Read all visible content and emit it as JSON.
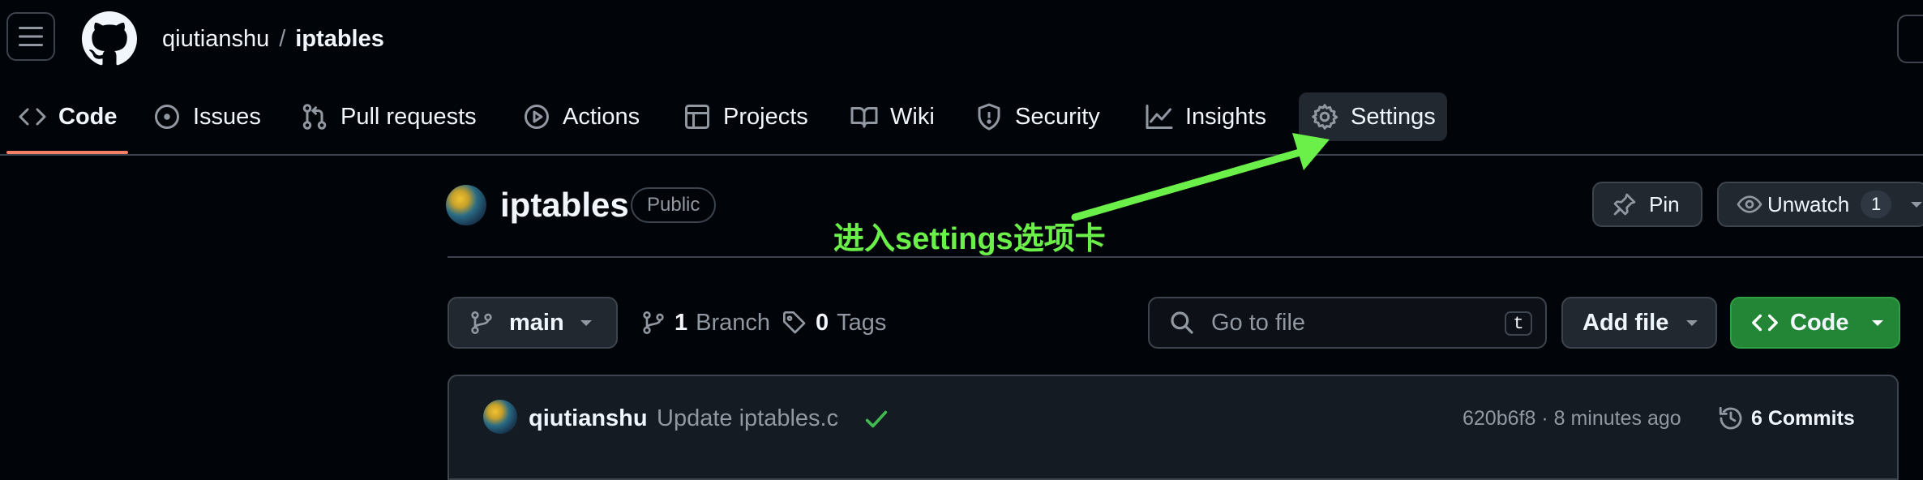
{
  "header": {
    "owner": "qiutianshu",
    "separator": "/",
    "repo": "iptables"
  },
  "tabs": [
    {
      "label": "Code",
      "icon": "code-icon",
      "active": true
    },
    {
      "label": "Issues",
      "icon": "issue-icon"
    },
    {
      "label": "Pull requests",
      "icon": "pull-request-icon"
    },
    {
      "label": "Actions",
      "icon": "play-icon"
    },
    {
      "label": "Projects",
      "icon": "table-icon"
    },
    {
      "label": "Wiki",
      "icon": "book-icon"
    },
    {
      "label": "Security",
      "icon": "shield-icon"
    },
    {
      "label": "Insights",
      "icon": "graph-icon"
    },
    {
      "label": "Settings",
      "icon": "gear-icon"
    }
  ],
  "repo_header": {
    "name": "iptables",
    "visibility": "Public",
    "pin_label": "Pin",
    "unwatch_label": "Unwatch",
    "watch_count": "1"
  },
  "annotation": {
    "text": "进入settings选项卡",
    "color": "#6bf04a"
  },
  "toolbar": {
    "branch": "main",
    "branch_count": "1",
    "branch_label": "Branch",
    "tag_count": "0",
    "tag_label": "Tags",
    "search_placeholder": "Go to file",
    "search_shortcut": "t",
    "add_file_label": "Add file",
    "code_label": "Code"
  },
  "commit": {
    "author": "qiutianshu",
    "message": "Update iptables.c",
    "hash": "620b6f8",
    "time": "8 minutes ago",
    "meta_separator": "·",
    "commit_count": "6",
    "commits_label": "Commits"
  },
  "colors": {
    "background": "#010409",
    "accent_underline": "#f78166",
    "code_button": "#238636"
  }
}
